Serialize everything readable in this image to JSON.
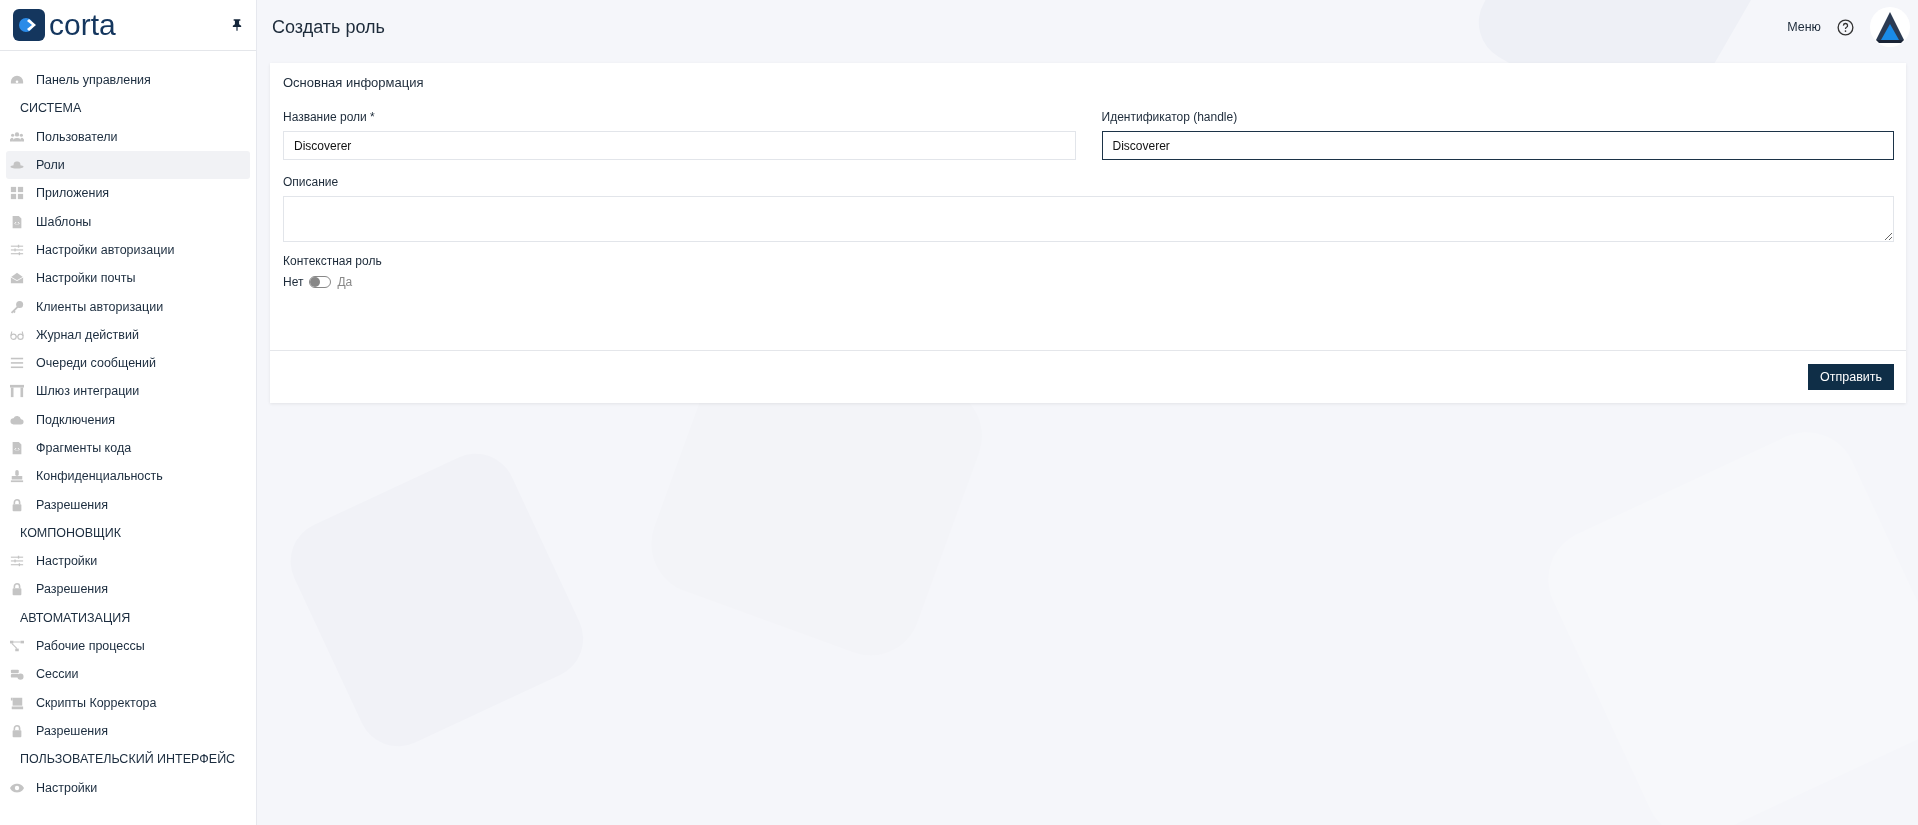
{
  "sidebar": {
    "logo": "corta",
    "items": [
      {
        "kind": "link",
        "label": "Панель управления",
        "selected": false
      },
      {
        "kind": "heading",
        "label": "СИСТЕМА"
      },
      {
        "kind": "link",
        "label": "Пользователи",
        "selected": false
      },
      {
        "kind": "link",
        "label": "Роли",
        "selected": true
      },
      {
        "kind": "link",
        "label": "Приложения",
        "selected": false
      },
      {
        "kind": "link",
        "label": "Шаблоны",
        "selected": false
      },
      {
        "kind": "link",
        "label": "Настройки авторизации",
        "selected": false
      },
      {
        "kind": "link",
        "label": "Настройки почты",
        "selected": false
      },
      {
        "kind": "link",
        "label": "Клиенты авторизации",
        "selected": false
      },
      {
        "kind": "link",
        "label": "Журнал действий",
        "selected": false
      },
      {
        "kind": "link",
        "label": "Очереди сообщений",
        "selected": false
      },
      {
        "kind": "link",
        "label": "Шлюз интеграции",
        "selected": false
      },
      {
        "kind": "link",
        "label": "Подключения",
        "selected": false
      },
      {
        "kind": "link",
        "label": "Фрагменты кода",
        "selected": false
      },
      {
        "kind": "link",
        "label": "Конфиденциальность",
        "selected": false
      },
      {
        "kind": "link",
        "label": "Разрешения",
        "selected": false
      },
      {
        "kind": "heading",
        "label": "КОМПОНОВЩИК"
      },
      {
        "kind": "link",
        "label": "Настройки",
        "selected": false
      },
      {
        "kind": "link",
        "label": "Разрешения",
        "selected": false
      },
      {
        "kind": "heading",
        "label": "АВТОМАТИЗАЦИЯ"
      },
      {
        "kind": "link",
        "label": "Рабочие процессы",
        "selected": false
      },
      {
        "kind": "link",
        "label": "Сессии",
        "selected": false
      },
      {
        "kind": "link",
        "label": "Скрипты Корректора",
        "selected": false
      },
      {
        "kind": "link",
        "label": "Разрешения",
        "selected": false
      },
      {
        "kind": "heading",
        "label": "ПОЛЬЗОВАТЕЛЬСКИЙ ИНТЕРФЕЙС"
      },
      {
        "kind": "link",
        "label": "Настройки",
        "selected": false
      }
    ]
  },
  "header": {
    "title": "Создать роль",
    "menu": "Меню"
  },
  "form": {
    "section_title": "Основная информация",
    "name": {
      "label": "Название роли *",
      "value": "Discoverer",
      "focused": false
    },
    "handle": {
      "label": "Идентификатор (handle)",
      "value": "Discoverer",
      "focused": true
    },
    "description": {
      "label": "Описание"
    },
    "contextual": {
      "label": "Контекстная роль",
      "off_label": "Нет",
      "on_label": "Да",
      "on": false
    },
    "submit": "Отправить"
  }
}
